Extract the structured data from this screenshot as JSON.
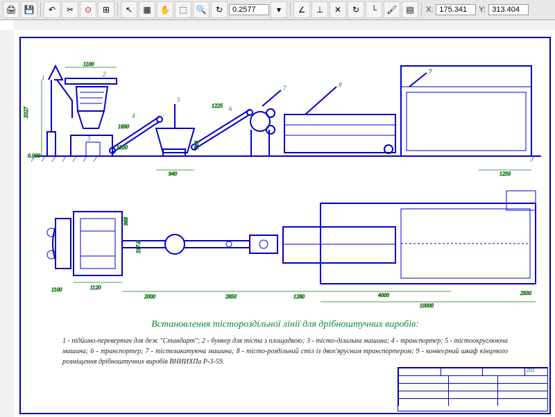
{
  "toolbar": {
    "zoom": "0.2577",
    "coord_x_label": "X:",
    "coord_x": "175.341",
    "coord_y_label": "Y:",
    "coord_y": "313.404"
  },
  "drawing": {
    "title": "Встановлення тістороздільної лінії для дрібноштучних виробів:",
    "legend": "1 - підйомо-перевертач для деж \"Стандарт\"; 2 - бункер для тіста з площадкою; 3 - тісто-ділильна машина; 4 - транспортер; 5 - тістоокруглююча машина; 6 - транспортер; 7 - тістозакатуюча машина; 8 - тісто-роздільний стіл із двох'ярусним транспортером; 9 - конвеєрний шкаф кінцевого розміщення дрібноштучних виробів ВНИИХПа Р-3-59.",
    "title_block": {
      "sheet": "201"
    }
  },
  "dims_side": {
    "d_1100": "1100",
    "d_3327": "3327",
    "d_0000": "0.000",
    "d_1690": "1690",
    "d_1200": "1200",
    "d_940": "940",
    "d_1225": "1225",
    "d_718": "718",
    "d_1250": "1250"
  },
  "dims_plan": {
    "d_1100a": "1100",
    "d_1120": "1120",
    "d_2000": "2000",
    "d_2950": "2950",
    "d_1280": "1280",
    "d_4000": "4000",
    "d_10000": "10000",
    "d_2930": "2930",
    "d_968": "968",
    "d_3178": "317.8"
  },
  "callouts": {
    "c1": "1",
    "c2": "2",
    "c3": "3",
    "c4": "4",
    "c5": "5",
    "c6": "6",
    "c7": "7",
    "c8": "8",
    "c9": "9"
  }
}
